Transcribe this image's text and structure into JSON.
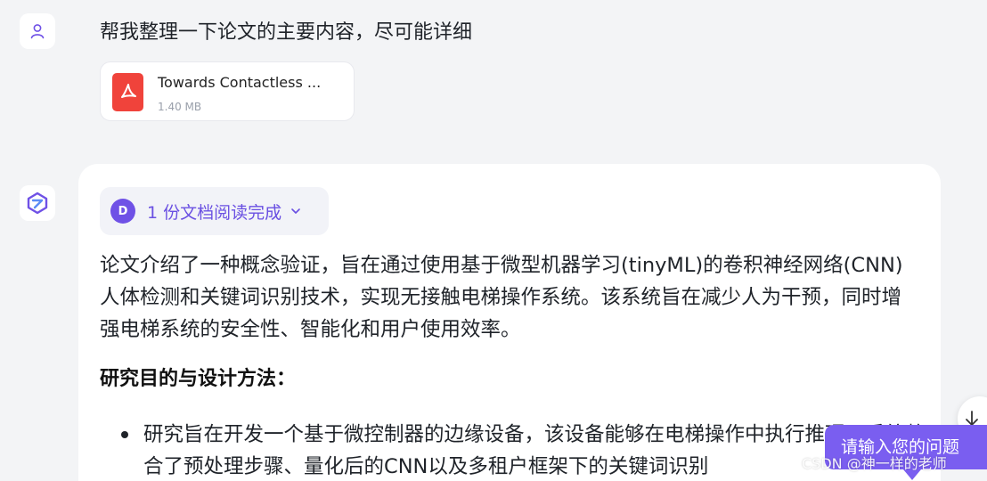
{
  "user_message": {
    "text": "帮我整理一下论文的主要内容，尽可能详细",
    "attachment": {
      "name": "Towards Contactless ...",
      "size": "1.40 MB",
      "icon": "pdf-icon"
    }
  },
  "assistant_message": {
    "documents_chip": {
      "badge": "D",
      "label": "1 份文档阅读完成"
    },
    "paragraph": "论文介绍了一种概念验证，旨在通过使用基于微型机器学习(tinyML)的卷积神经网络(CNN)人体检测和关键词识别技术，实现无接触电梯操作系统。该系统旨在减少人为干预，同时增强电梯系统的安全性、智能化和用户使用效率。",
    "heading": "研究目的与设计方法：",
    "bullets": [
      "研究旨在开发一个基于微控制器的边缘设备，该设备能够在电梯操作中执行推理，系统整合了预处理步骤、量化后的CNN以及多租户框架下的关键词识别"
    ]
  },
  "controls": {
    "input_placeholder": "请输入您的问题",
    "scroll_icon": "arrow-down-icon"
  },
  "watermark": "CSDN @神一样的老师",
  "colors": {
    "accent": "#7a5ef0",
    "pdf_red": "#f0433b",
    "chip_text": "#6a50e2"
  }
}
